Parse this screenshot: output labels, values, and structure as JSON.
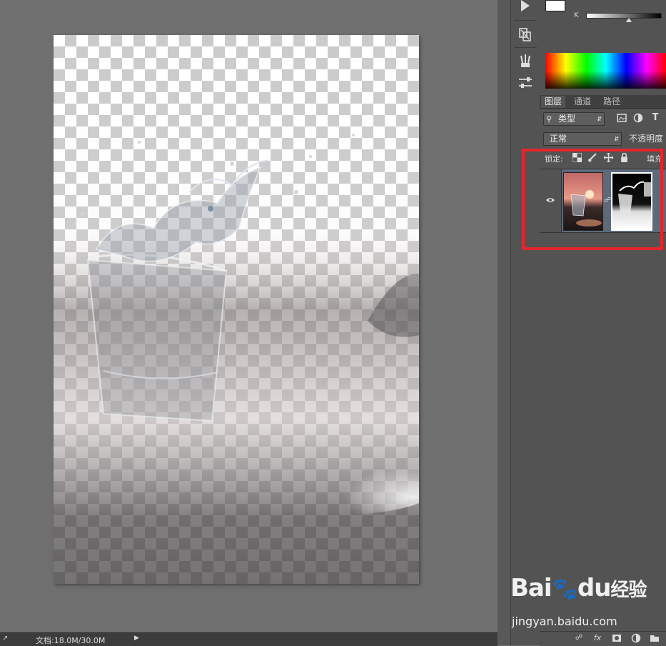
{
  "document": {
    "status_text": "文档:18.0M/30.0M"
  },
  "color_panel": {
    "k_label": "K"
  },
  "layers_panel": {
    "tabs": [
      {
        "label": "图层",
        "active": true
      },
      {
        "label": "通道",
        "active": false
      },
      {
        "label": "路径",
        "active": false
      }
    ],
    "filter_type": "类型",
    "blend_mode": "正常",
    "opacity_label": "不透明度",
    "lock_label": "锁定:",
    "fill_label": "填充",
    "layer": {
      "visible": true
    }
  },
  "icons": {
    "play": "play-icon",
    "clone_source": "clone-source-icon",
    "brush_presets": "brush-presets-icon",
    "adjustments": "adjustments-icon"
  },
  "accent_colors": {
    "highlight": "#e3262c",
    "panel": "#535353",
    "selection": "#5e6a7a"
  },
  "watermark": {
    "brand": "Bai",
    "paw": "du",
    "suffix": "经验",
    "url": "jingyan.baidu.com"
  }
}
